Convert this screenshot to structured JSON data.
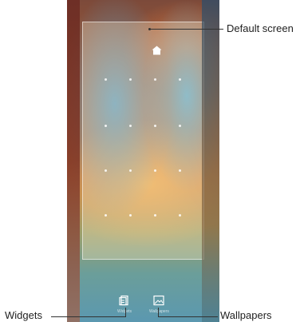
{
  "screen": {
    "options": [
      {
        "label": "Widgets",
        "icon": "widgets-icon"
      },
      {
        "label": "Wallpapers",
        "icon": "wallpapers-icon"
      }
    ],
    "home_icon": "home-icon"
  },
  "callouts": {
    "default_screen": "Default screen",
    "widgets": "Widgets",
    "wallpapers": "Wallpapers"
  }
}
